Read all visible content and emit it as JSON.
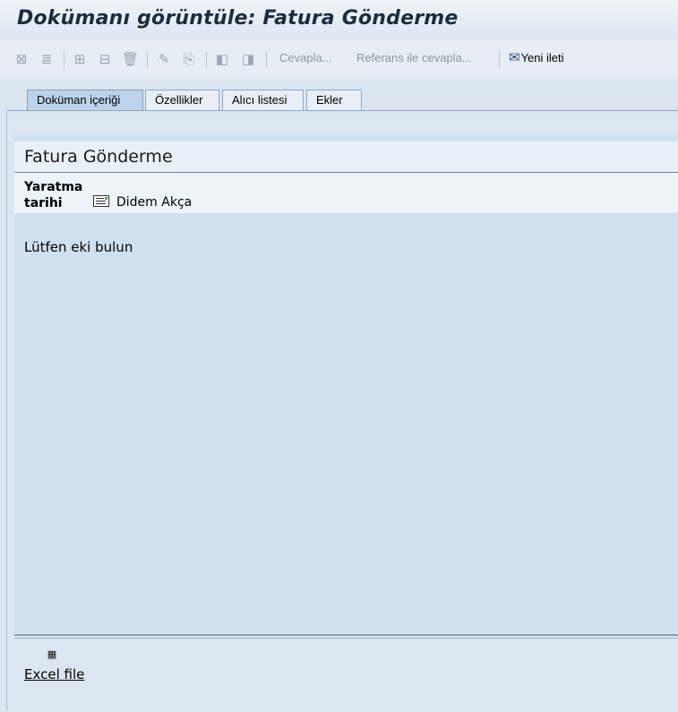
{
  "window": {
    "title": "Dokümanı görüntüle: Fatura Gönderme"
  },
  "toolbar": {
    "icons": [
      "close-window-icon",
      "print-icon",
      "hierarchy-icon",
      "structure-icon",
      "delete-icon",
      "edit-icon",
      "attachment-icon",
      "previous-icon",
      "next-icon"
    ],
    "reply_label": "Cevapla...",
    "reply_with_reference_label": "Referans ile cevapla...",
    "new_message_label": "Yeni ileti"
  },
  "tabs": [
    {
      "label": "Doküman içeriği",
      "active": true
    },
    {
      "label": "Özellikler",
      "active": false
    },
    {
      "label": "Alıcı listesi",
      "active": false
    },
    {
      "label": "Ekler",
      "active": false
    }
  ],
  "document": {
    "title": "Fatura Gönderme",
    "created_label": "Yaratma tarihi",
    "created_by": "Didem Akça",
    "body": "Lütfen eki bulun"
  },
  "attachments": [
    {
      "name": "Excel file",
      "icon": "excel-file-icon"
    }
  ]
}
